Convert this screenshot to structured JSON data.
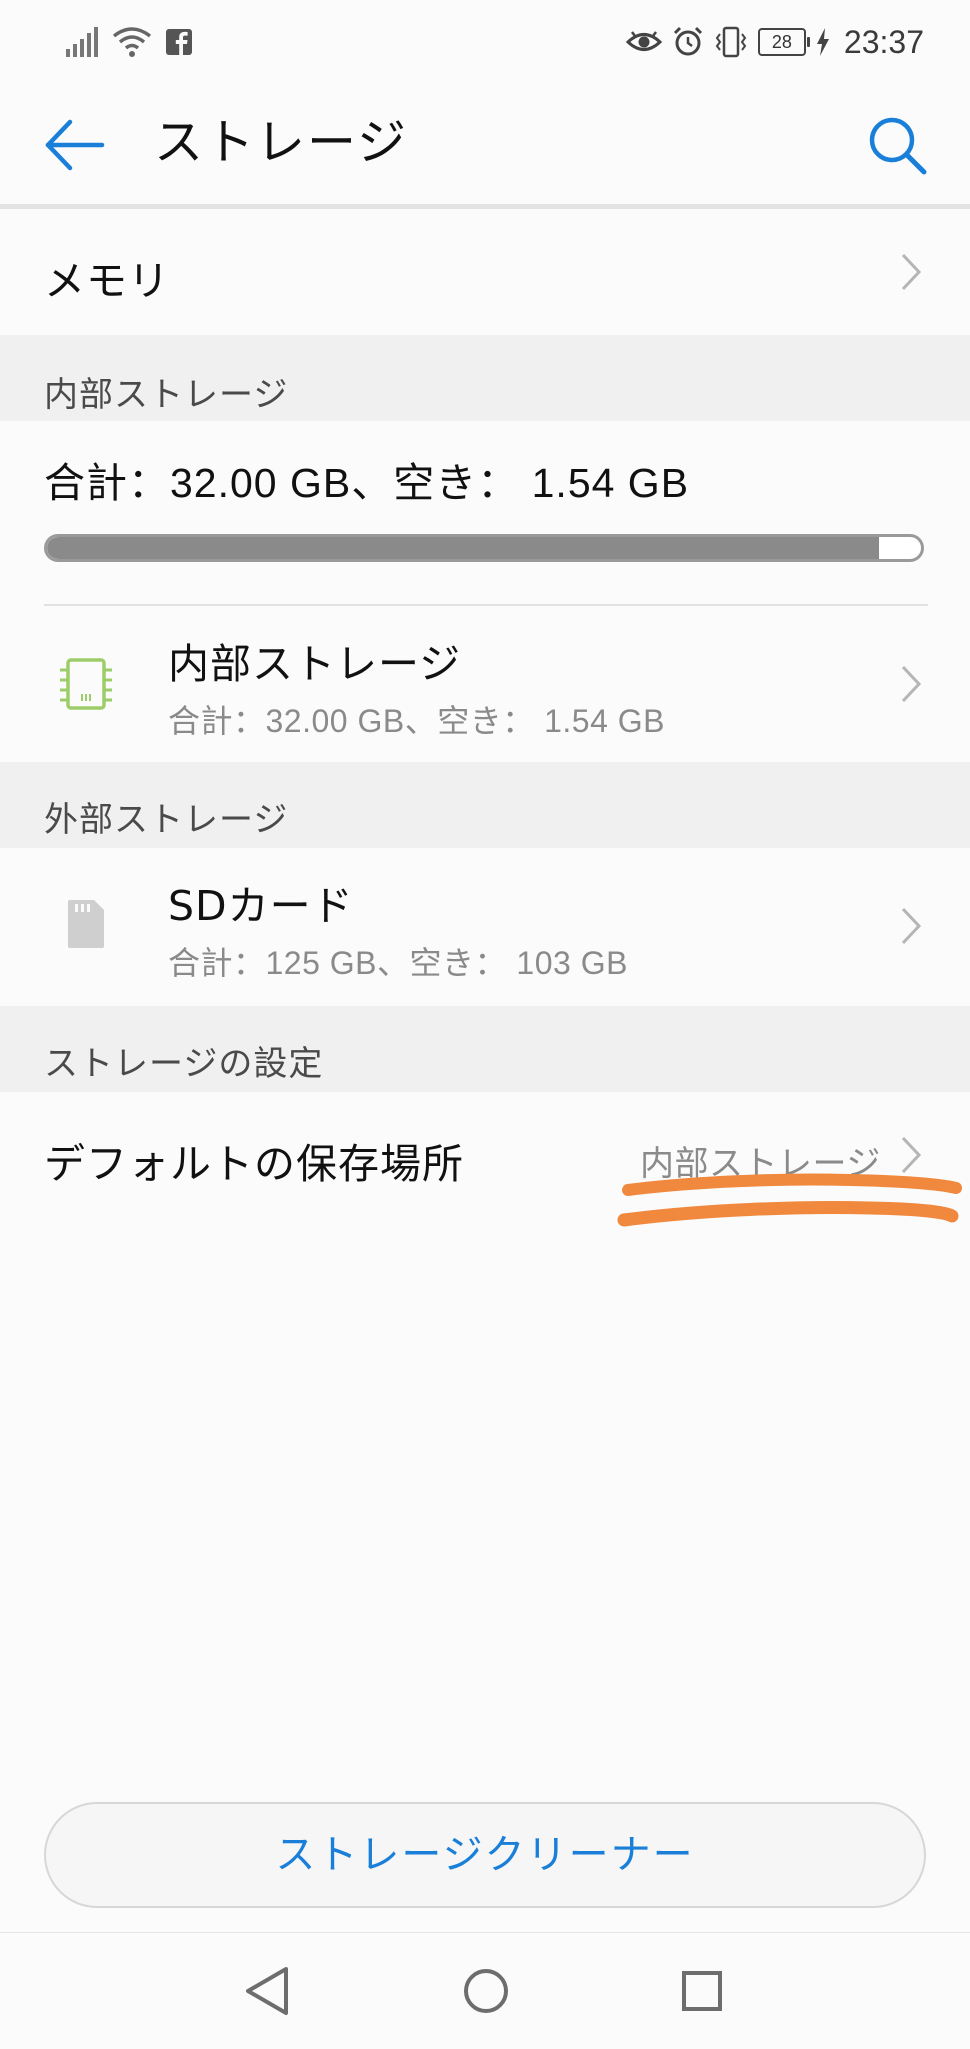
{
  "status_bar": {
    "time": "23:37",
    "battery_level": "28",
    "left_icons": [
      "signal-icon",
      "wifi-icon",
      "facebook-icon"
    ],
    "right_icons": [
      "eye-comfort-icon",
      "alarm-icon",
      "vibrate-icon",
      "battery-icon",
      "charging-icon"
    ]
  },
  "app_bar": {
    "title": "ストレージ",
    "back_icon": "back-arrow-icon",
    "search_icon": "search-icon"
  },
  "memory_row": {
    "label": "メモリ"
  },
  "internal_section": {
    "header": "内部ストレージ",
    "summary": "合計：32.00 GB、空き： 1.54 GB",
    "used_fraction": 0.952,
    "item": {
      "icon": "chip-icon",
      "title": "内部ストレージ",
      "subtitle": "合計：32.00 GB、空き： 1.54 GB"
    }
  },
  "external_section": {
    "header": "外部ストレージ",
    "item": {
      "icon": "sd-card-icon",
      "title": "SDカード",
      "subtitle": "合計：125 GB、空き： 103 GB"
    }
  },
  "settings_section": {
    "header": "ストレージの設定",
    "default_location": {
      "label": "デフォルトの保存場所",
      "value": "内部ストレージ"
    }
  },
  "cleaner_button": {
    "label": "ストレージクリーナー"
  },
  "nav_bar": {
    "buttons": [
      "back-nav-icon",
      "home-nav-icon",
      "recents-nav-icon"
    ]
  },
  "colors": {
    "accent": "#1a7fd8",
    "annotation": "#f0883e",
    "chip_icon": "#9ccd6a",
    "progress_fill": "#8a8a8a"
  }
}
